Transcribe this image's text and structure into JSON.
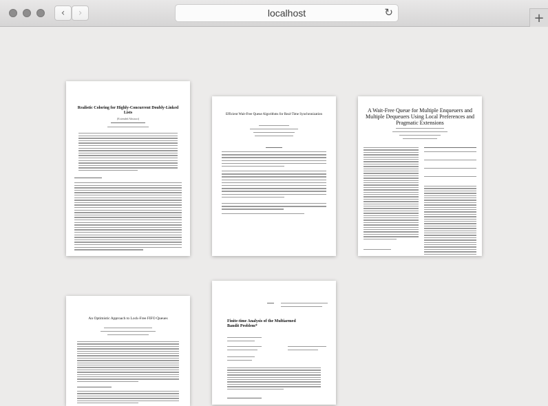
{
  "browser": {
    "url": "localhost",
    "back_icon": "‹",
    "forward_icon": "›",
    "reload_icon": "↻",
    "newtab_icon": "+"
  },
  "papers": [
    {
      "title": "Realistic Coloring for Highly-Concurrent Doubly-Linked Lists",
      "subtitle": "(Extended Abstract)"
    },
    {
      "title": "Efficient Wait-Free Queue Algorithms for Real-Time Synchronization"
    },
    {
      "title": "A Wait-Free Queue for Multiple Enqueuers and Multiple Dequeuers Using Local Preferences and Pragmatic Extensions"
    },
    {
      "title": "An Optimistic Approach to Lock-Free FIFO Queues"
    },
    {
      "title": "Finite-time Analysis of the Multiarmed Bandit Problem*"
    }
  ]
}
